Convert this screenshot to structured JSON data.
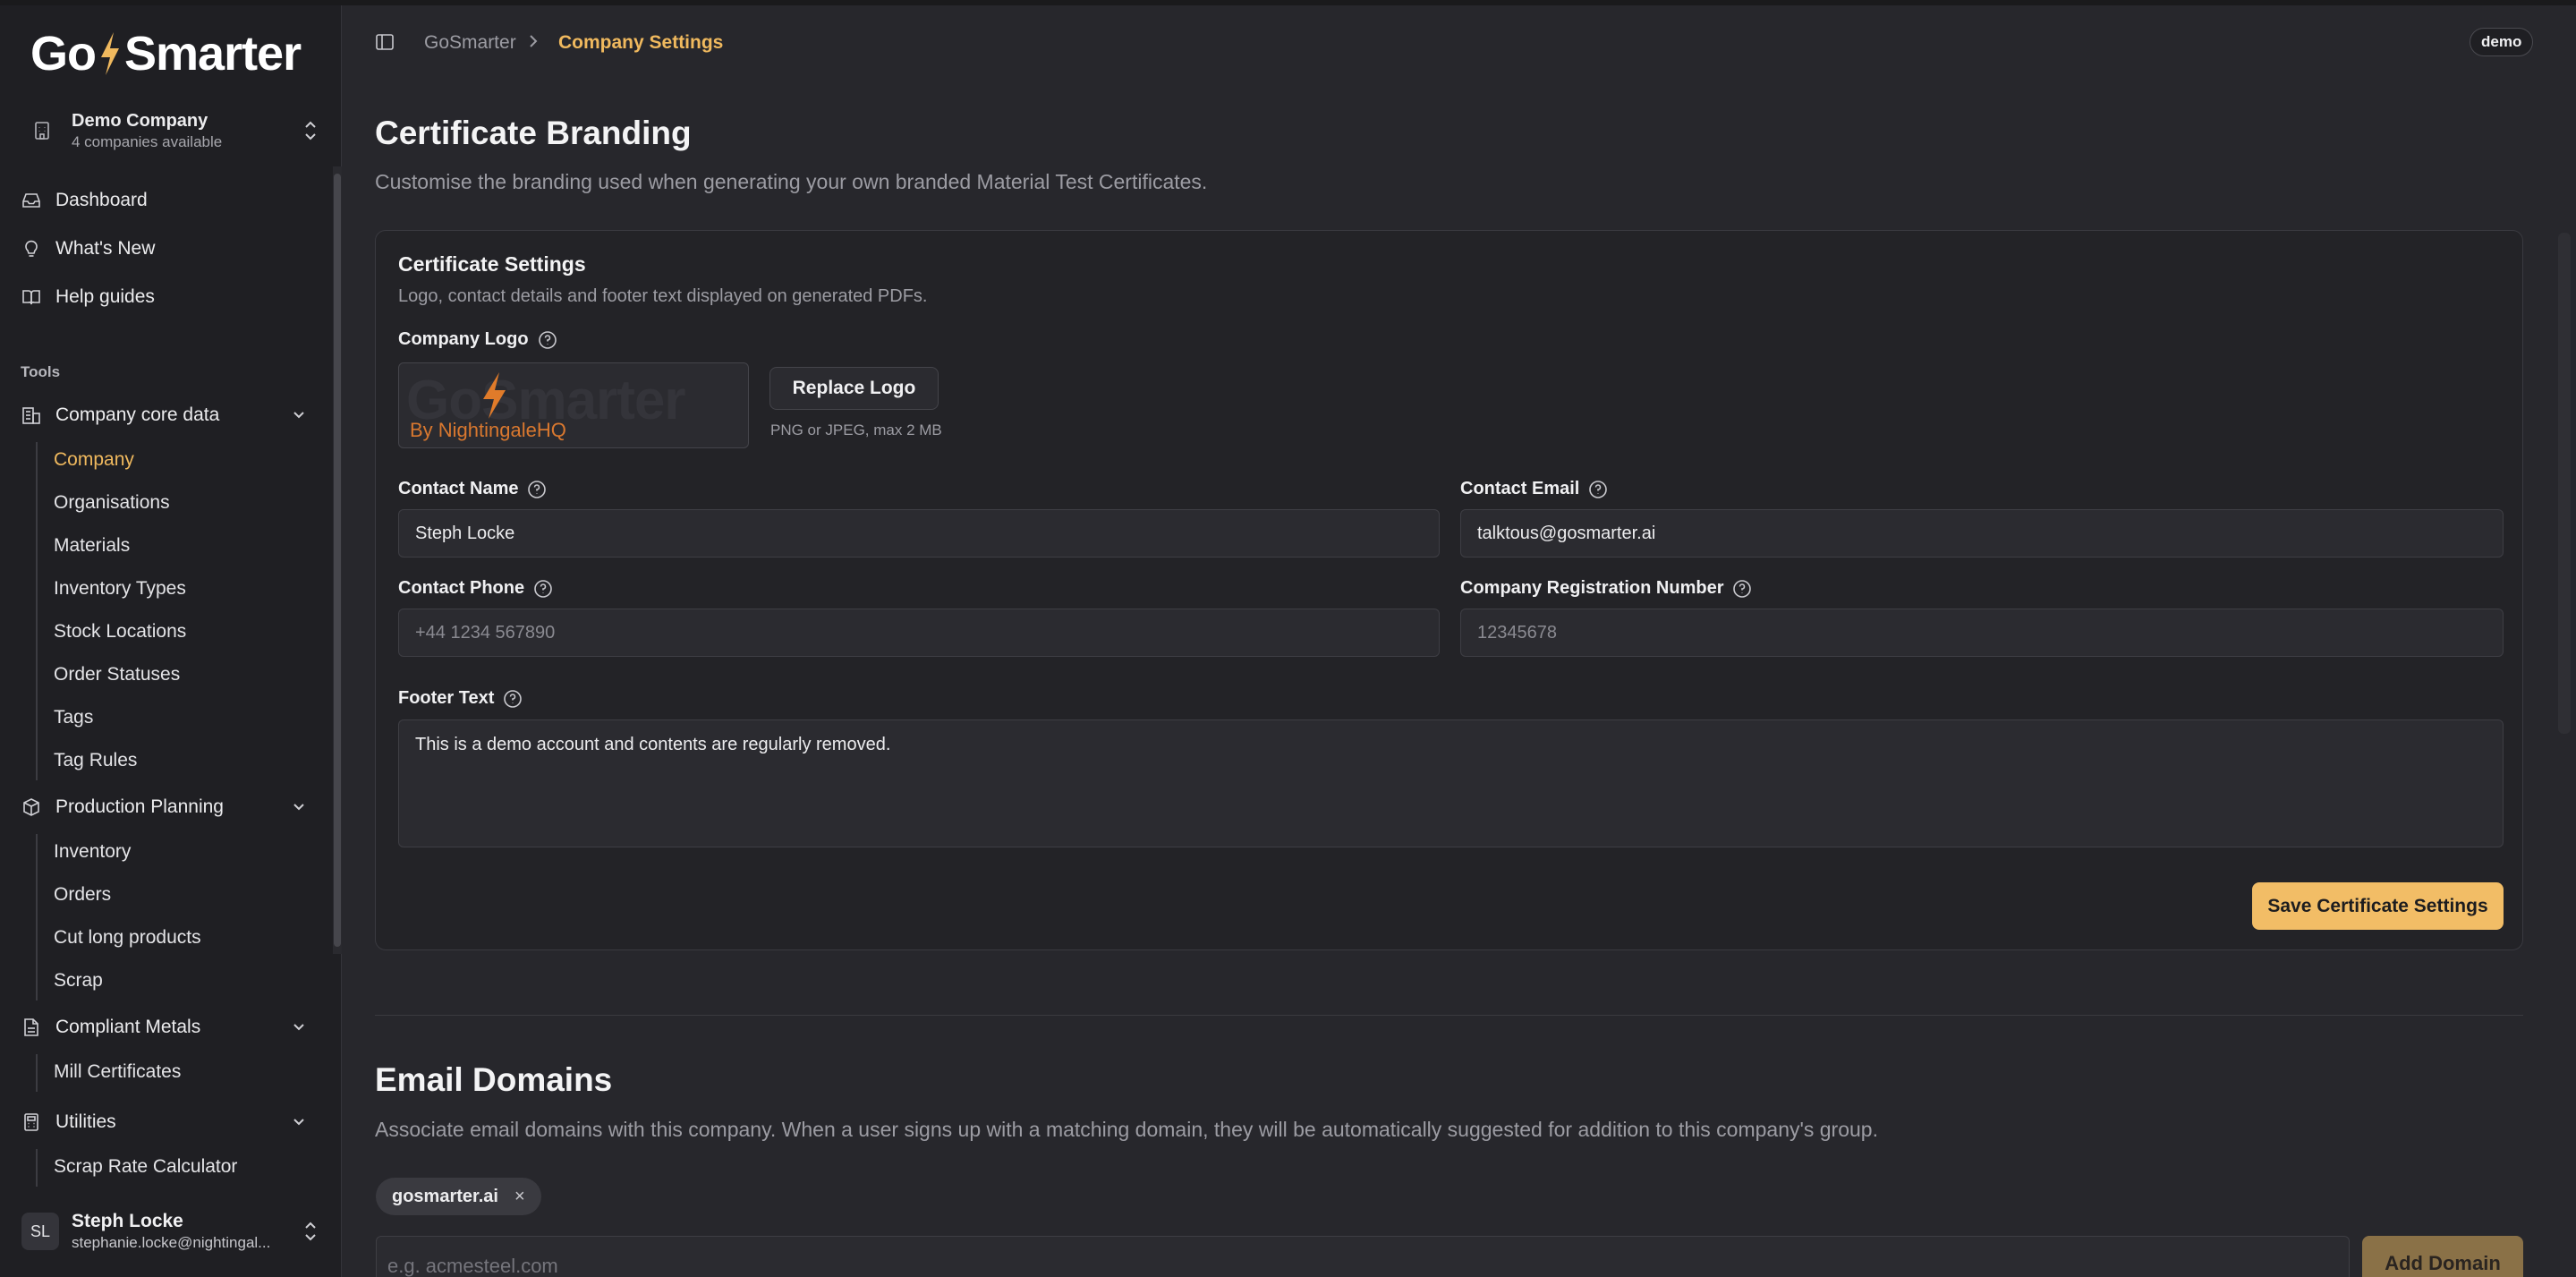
{
  "app": {
    "logo_text_left": "Go",
    "logo_text_right": "Smarter",
    "accent_color": "#f0b95e",
    "primary_button_color": "#f2bd66"
  },
  "company_switcher": {
    "name": "Demo Company",
    "subtitle": "4 companies available"
  },
  "nav": {
    "top_items": [
      {
        "label": "Dashboard",
        "icon": "inbox-icon"
      },
      {
        "label": "What's New",
        "icon": "lightbulb-icon"
      },
      {
        "label": "Help guides",
        "icon": "book-icon"
      }
    ],
    "section_label": "Tools",
    "groups": [
      {
        "label": "Company core data",
        "icon": "building-icon",
        "items": [
          "Company",
          "Organisations",
          "Materials",
          "Inventory Types",
          "Stock Locations",
          "Order Statuses",
          "Tags",
          "Tag Rules"
        ],
        "active": "Company"
      },
      {
        "label": "Production Planning",
        "icon": "box-icon",
        "items": [
          "Inventory",
          "Orders",
          "Cut long products",
          "Scrap"
        ]
      },
      {
        "label": "Compliant Metals",
        "icon": "document-icon",
        "items": [
          "Mill Certificates"
        ]
      },
      {
        "label": "Utilities",
        "icon": "calculator-icon",
        "items": [
          "Scrap Rate Calculator"
        ]
      }
    ]
  },
  "user": {
    "initials": "SL",
    "name": "Steph Locke",
    "email": "stephanie.locke@nightingal..."
  },
  "header": {
    "breadcrumb_root": "GoSmarter",
    "breadcrumb_current": "Company Settings",
    "env_badge": "demo"
  },
  "page": {
    "title": "Certificate Branding",
    "subtitle": "Customise the branding used when generating your own branded Material Test Certificates."
  },
  "card": {
    "title": "Certificate Settings",
    "description": "Logo, contact details and footer text displayed on generated PDFs.",
    "logo_label": "Company Logo",
    "logo_ghost_text": "GoSmarter",
    "logo_by": "By NightingaleHQ",
    "replace_logo": "Replace Logo",
    "logo_hint": "PNG or JPEG, max 2 MB",
    "contact_name_label": "Contact Name",
    "contact_name_value": "Steph Locke",
    "contact_email_label": "Contact Email",
    "contact_email_value": "talktous@gosmarter.ai",
    "contact_phone_label": "Contact Phone",
    "contact_phone_placeholder": "+44 1234 567890",
    "reg_number_label": "Company Registration Number",
    "reg_number_placeholder": "12345678",
    "footer_label": "Footer Text",
    "footer_value": "This is a demo account and contents are regularly removed.",
    "save_button": "Save Certificate Settings"
  },
  "email_domains": {
    "title": "Email Domains",
    "description": "Associate email domains with this company. When a user signs up with a matching domain, they will be automatically suggested for addition to this company's group.",
    "chips": [
      "gosmarter.ai"
    ],
    "chip_remove": "×",
    "input_placeholder": "e.g. acmesteel.com",
    "add_button": "Add Domain"
  }
}
